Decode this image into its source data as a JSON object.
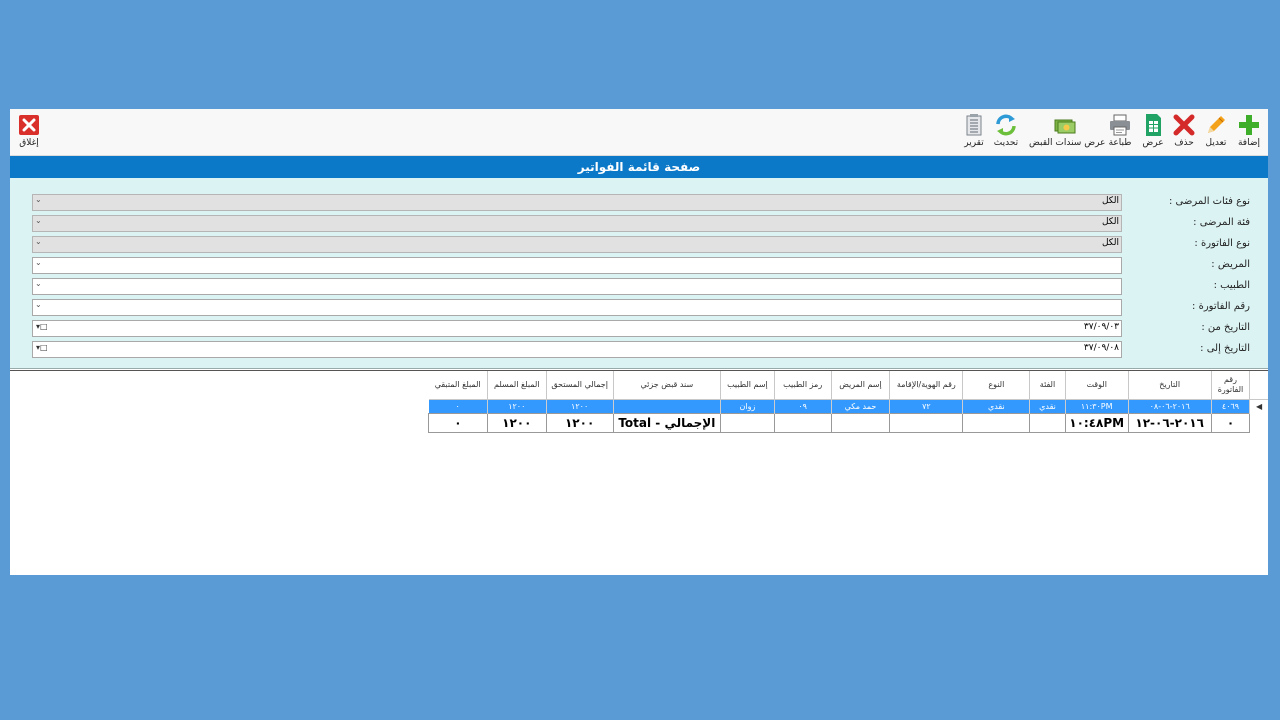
{
  "toolbar": {
    "close": "إغلاق",
    "add": "إضافة",
    "edit": "تعديل",
    "delete": "حذف",
    "view": "عرض",
    "print": "طباعة",
    "receipts": "عرض سندات القبض",
    "refresh": "تحديث",
    "report": "تقرير"
  },
  "page_title": "صفحة قائمة الفواتير",
  "filters": [
    {
      "label": "نوع فئات المرضى :",
      "value": "الكل"
    },
    {
      "label": "فئة المرضى :",
      "value": "الكل"
    },
    {
      "label": "نوع الفاتورة :",
      "value": "الكل"
    },
    {
      "label": "المريض :",
      "value": ""
    },
    {
      "label": "الطبيب :",
      "value": ""
    },
    {
      "label": "رقم الفاتورة :",
      "value": ""
    },
    {
      "label": "التاريخ من :",
      "value": "٣٧/٠٩/٠٣"
    },
    {
      "label": "التاريخ إلى :",
      "value": "٣٧/٠٩/٠٨"
    }
  ],
  "grid": {
    "headers": [
      "رقم الفاتورة",
      "التاريخ",
      "الوقت",
      "الفئة",
      "النوع",
      "رقم الهوية/الإقامة",
      "إسم المريض",
      "رمز الطبيب",
      "إسم الطبيب",
      "سند قبض جزئي",
      "إجمالي المستحق",
      "المبلغ المسلم",
      "المبلغ المتبقي"
    ],
    "rows": [
      [
        "٤٠٦٩",
        "٢٠١٦-٠٦-٠٨",
        "١١:٣٠PM",
        "نقدي",
        "نقدي",
        "٧٢",
        "حمد مكي",
        "٠٩",
        "زوان",
        "",
        "١٢٠٠",
        "١٢٠٠",
        "٠"
      ]
    ],
    "totals": [
      "٠",
      "٢٠١٦-٠٦-١٢",
      "١٠:٤٨PM",
      "",
      "",
      "",
      "",
      "",
      "",
      "الإجمالي - Total",
      "١٢٠٠",
      "١٢٠٠",
      "٠"
    ]
  },
  "colors": {
    "background": "#5b9bd5",
    "title_bar": "#0b78c8",
    "filter_panel": "#dcf3f3",
    "selected_row": "#3399ff"
  }
}
